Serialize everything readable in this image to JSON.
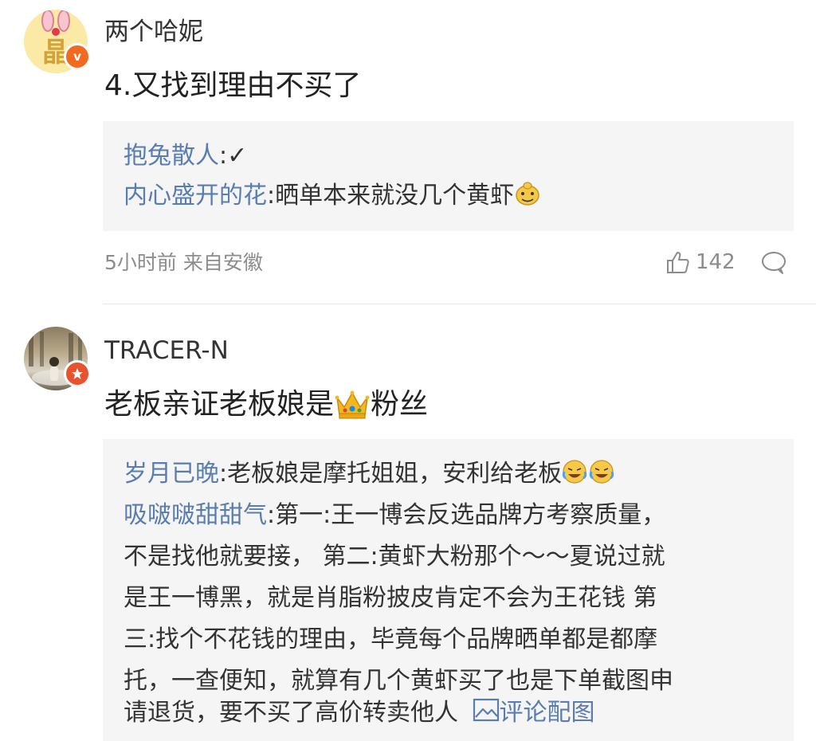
{
  "comments": [
    {
      "username": "两个哈妮",
      "avatar_glyph": "晶",
      "badge_icon": "v-verified-icon",
      "badge_text": "v",
      "text": "4.又找到理由不买了",
      "replies": [
        {
          "user": "抱兔散人",
          "text": ":✓"
        },
        {
          "user": "内心盛开的花",
          "text": ":晒单本来就没几个黄虾"
        }
      ],
      "meta": "5小时前 来自安徽",
      "likes": "142"
    },
    {
      "username": "TRACER-N",
      "badge_icon": "star-badge-icon",
      "text_before": "老板亲证老板娘是",
      "text_after": "粉丝",
      "replies": [
        {
          "user": "岁月已晚",
          "text": ":老板娘是摩托姐姐，安利给老板"
        },
        {
          "user": "吸啵啵甜甜气",
          "text": ":第一:王一博会反选品牌方考察质量，",
          "continuation": [
            "不是找他就要接， 第二:黄虾大粉那个～～夏说过就",
            "是王一博黑，就是肖脂粉披皮肯定不会为王花钱 第",
            "三:找个不花钱的理由，毕竟每个品牌晒单都是都摩",
            "托，一查便知，就算有几个黄虾买了也是下单截图申",
            "请退货，要不买了高价转卖他人"
          ],
          "image_link": "评论配图"
        }
      ]
    }
  ],
  "colors": {
    "reply_user": "#5a7db1",
    "badge": "#f06b21",
    "reply_bg": "#f5f5f5"
  }
}
